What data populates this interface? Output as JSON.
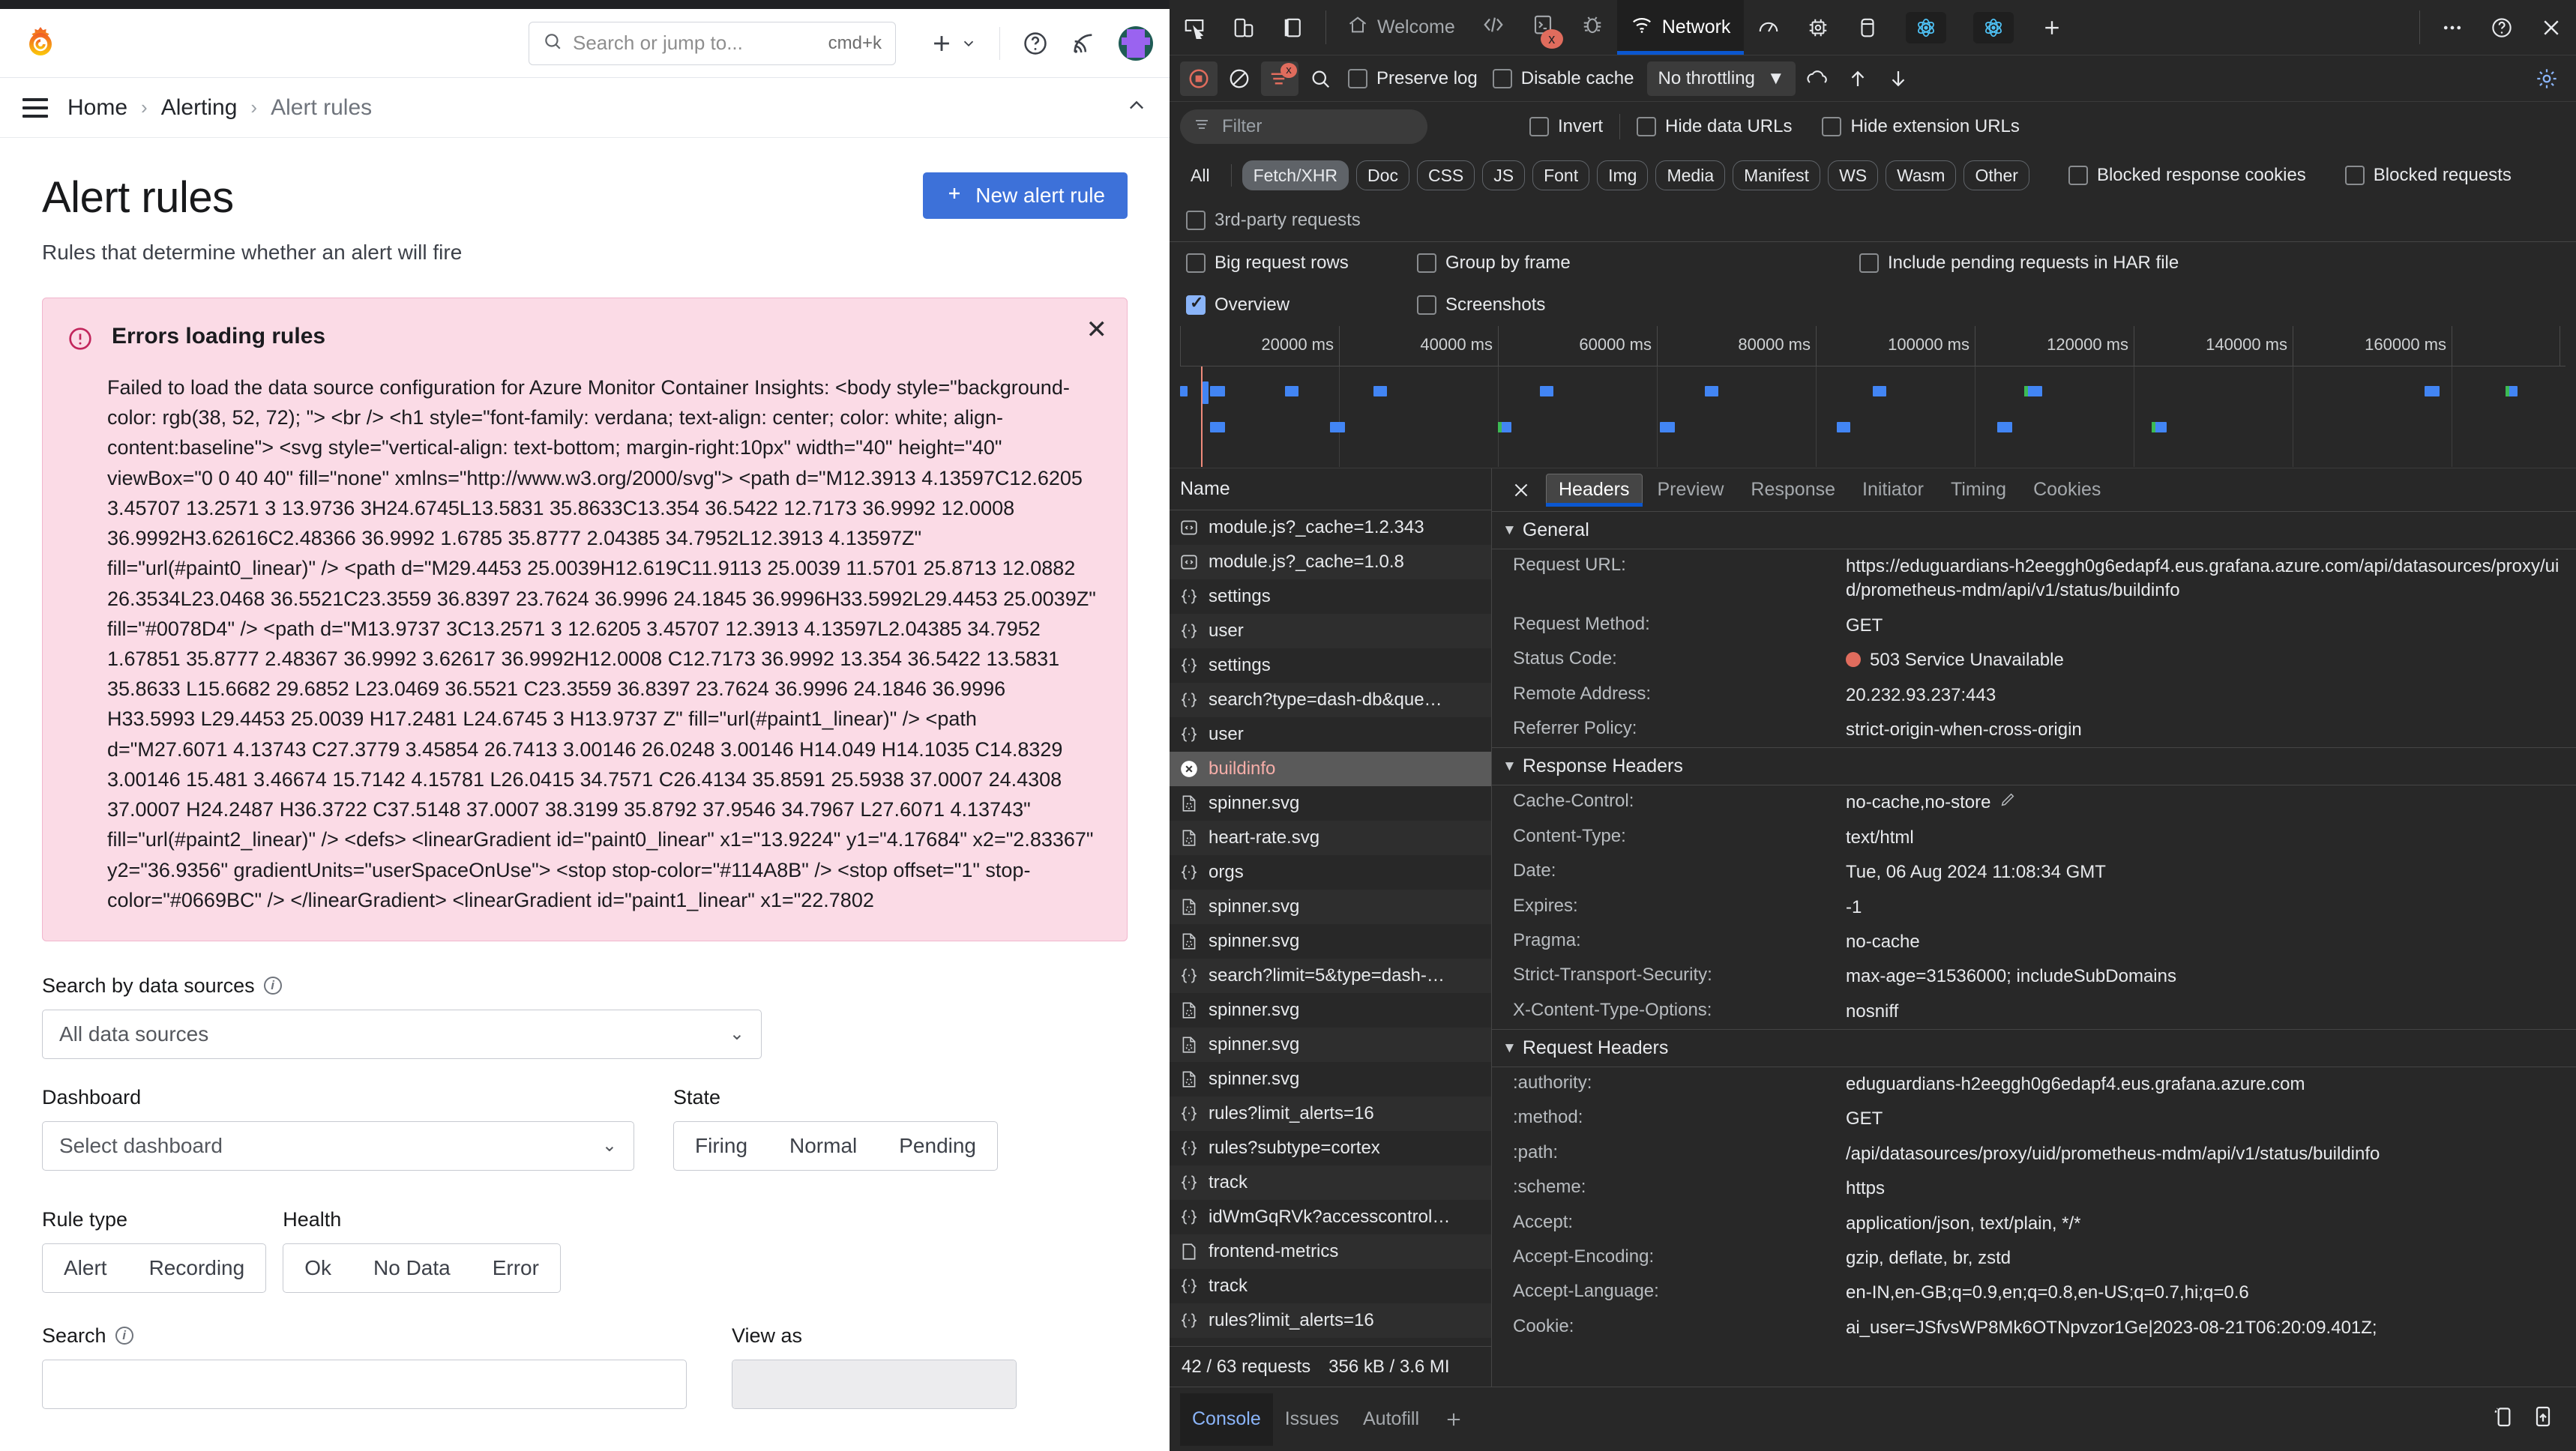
{
  "grafana": {
    "search": {
      "placeholder": "Search or jump to...",
      "shortcut": "cmd+k"
    },
    "breadcrumb": [
      "Home",
      "Alerting",
      "Alert rules"
    ],
    "page_title": "Alert rules",
    "page_subtitle": "Rules that determine whether an alert will fire",
    "new_rule_button": "New alert rule",
    "alert": {
      "title": "Errors loading rules",
      "message": "Failed to load the data source configuration for Azure Monitor Container Insights: <body style=\"background-color: rgb(38, 52, 72); \"> <br /> <h1 style=\"font-family: verdana; text-align: center; color: white; align-content:baseline\"> <svg style=\"vertical-align: text-bottom; margin-right:10px\" width=\"40\" height=\"40\" viewBox=\"0 0 40 40\" fill=\"none\" xmlns=\"http://www.w3.org/2000/svg\"> <path d=\"M12.3913 4.13597C12.6205 3.45707 13.2571 3 13.9736 3H24.6745L13.5831 35.8633C13.354 36.5422 12.7173 36.9992 12.0008 36.9992H3.62616C2.48366 36.9992 1.6785 35.8777 2.04385 34.7952L12.3913 4.13597Z\" fill=\"url(#paint0_linear)\" /> <path d=\"M29.4453 25.0039H12.619C11.9113 25.0039 11.5701 25.8713 12.0882 26.3534L23.0468 36.5521C23.3559 36.8397 23.7624 36.9996 24.1845 36.9996H33.5992L29.4453 25.0039Z\" fill=\"#0078D4\" /> <path d=\"M13.9737 3C13.2571 3 12.6205 3.45707 12.3913 4.13597L2.04385 34.7952 1.67851 35.8777 2.48367 36.9992 3.62617 36.9992H12.0008 C12.7173 36.9992 13.354 36.5422 13.5831 35.8633 L15.6682 29.6852 L23.0469 36.5521 C23.3559 36.8397 23.7624 36.9996 24.1846 36.9996 H33.5993 L29.4453 25.0039 H17.2481 L24.6745 3 H13.9737 Z\" fill=\"url(#paint1_linear)\" /> <path d=\"M27.6071 4.13743 C27.3779 3.45854 26.7413 3.00146 26.0248 3.00146 H14.049 H14.1035 C14.8329 3.00146 15.481 3.46674 15.7142 4.15781 L26.0415 34.7571 C26.4134 35.8591 25.5938 37.0007 24.4308 37.0007 H24.2487 H36.3722 C37.5148 37.0007 38.3199 35.8792 37.9546 34.7967 L27.6071 4.13743\" fill=\"url(#paint2_linear)\" /> <defs> <linearGradient id=\"paint0_linear\" x1=\"13.9224\" y1=\"4.17684\" x2=\"2.83367\" y2=\"36.9356\" gradientUnits=\"userSpaceOnUse\"> <stop stop-color=\"#114A8B\" /> <stop offset=\"1\" stop-color=\"#0669BC\" /> </linearGradient> <linearGradient id=\"paint1_linear\" x1=\"22.7802",
      "close": "✕"
    },
    "filters": {
      "data_sources_label": "Search by data sources",
      "data_sources_value": "All data sources",
      "dashboard_label": "Dashboard",
      "dashboard_value": "Select dashboard",
      "state_label": "State",
      "state_options": [
        "Firing",
        "Normal",
        "Pending"
      ],
      "rule_type_label": "Rule type",
      "rule_type_options": [
        "Alert",
        "Recording"
      ],
      "health_label": "Health",
      "health_options": [
        "Ok",
        "No Data",
        "Error"
      ],
      "search_label": "Search",
      "view_as_label": "View as"
    }
  },
  "devtools": {
    "panel_tabs": [
      {
        "label": "Welcome",
        "icon": "home-icon",
        "active": false
      },
      {
        "label": "",
        "icon": "elements-icon",
        "active": false
      },
      {
        "label": "",
        "icon": "console-error-icon",
        "active": false
      },
      {
        "label": "",
        "icon": "bug-icon",
        "active": false
      },
      {
        "label": "Network",
        "icon": "network-icon",
        "active": true
      }
    ],
    "right_tab_icons": [
      "performance-icon",
      "memory-icon",
      "application-icon",
      "react-components-icon",
      "react-profiler-icon",
      "more-tabs-icon"
    ],
    "window_icons": [
      "more-options-icon",
      "help-icon",
      "close-icon"
    ],
    "toolbar": {
      "record_label": "record",
      "clear_label": "clear",
      "filter_label": "Filter",
      "search_label": "search",
      "preserve_log": "Preserve log",
      "disable_cache": "Disable cache",
      "throttling": "No throttling"
    },
    "filter_row": {
      "placeholder": "Filter",
      "invert": "Invert",
      "hide_data_urls": "Hide data URLs",
      "hide_extension_urls": "Hide extension URLs"
    },
    "resource_types": [
      "All",
      "Fetch/XHR",
      "Doc",
      "CSS",
      "JS",
      "Font",
      "Img",
      "Media",
      "Manifest",
      "WS",
      "Wasm",
      "Other"
    ],
    "selected_resource_type": "Fetch/XHR",
    "blocked_response_cookies": "Blocked response cookies",
    "blocked_requests": "Blocked requests",
    "third_party_requests": "3rd-party requests",
    "settings_checks": {
      "big_request_rows": "Big request rows",
      "group_by_frame": "Group by frame",
      "include_pending_har": "Include pending requests in HAR file",
      "overview": "Overview",
      "screenshots": "Screenshots"
    },
    "overview_ticks": [
      "20000 ms",
      "40000 ms",
      "60000 ms",
      "80000 ms",
      "100000 ms",
      "120000 ms",
      "140000 ms",
      "160000 ms"
    ],
    "request_table": {
      "column_header": "Name",
      "rows": [
        {
          "name": "module.js?_cache=1.2.343",
          "icon": "js-icon",
          "selected": false
        },
        {
          "name": "module.js?_cache=1.0.8",
          "icon": "js-icon",
          "selected": false
        },
        {
          "name": "settings",
          "icon": "json-icon",
          "selected": false
        },
        {
          "name": "user",
          "icon": "json-icon",
          "selected": false
        },
        {
          "name": "settings",
          "icon": "json-icon",
          "selected": false
        },
        {
          "name": "search?type=dash-db&que…",
          "icon": "json-icon",
          "selected": false
        },
        {
          "name": "user",
          "icon": "json-icon",
          "selected": false
        },
        {
          "name": "buildinfo",
          "icon": "error-icon",
          "selected": true
        },
        {
          "name": "spinner.svg",
          "icon": "image-icon",
          "selected": false
        },
        {
          "name": "heart-rate.svg",
          "icon": "image-icon",
          "selected": false
        },
        {
          "name": "orgs",
          "icon": "json-icon",
          "selected": false
        },
        {
          "name": "spinner.svg",
          "icon": "image-icon",
          "selected": false
        },
        {
          "name": "spinner.svg",
          "icon": "image-icon",
          "selected": false
        },
        {
          "name": "search?limit=5&type=dash-…",
          "icon": "json-icon",
          "selected": false
        },
        {
          "name": "spinner.svg",
          "icon": "image-icon",
          "selected": false
        },
        {
          "name": "spinner.svg",
          "icon": "image-icon",
          "selected": false
        },
        {
          "name": "spinner.svg",
          "icon": "image-icon",
          "selected": false
        },
        {
          "name": "rules?limit_alerts=16",
          "icon": "json-icon",
          "selected": false
        },
        {
          "name": "rules?subtype=cortex",
          "icon": "json-icon",
          "selected": false
        },
        {
          "name": "track",
          "icon": "json-icon",
          "selected": false
        },
        {
          "name": "idWmGqRVk?accesscontrol…",
          "icon": "json-icon",
          "selected": false
        },
        {
          "name": "frontend-metrics",
          "icon": "doc-icon",
          "selected": false
        },
        {
          "name": "track",
          "icon": "json-icon",
          "selected": false
        },
        {
          "name": "rules?limit_alerts=16",
          "icon": "json-icon",
          "selected": false
        }
      ],
      "status_requests": "42 / 63 requests",
      "status_transferred": "356 kB / 3.6 MI"
    },
    "detail_tabs": [
      "Headers",
      "Preview",
      "Response",
      "Initiator",
      "Timing",
      "Cookies"
    ],
    "detail_active_tab": "Headers",
    "general_section": {
      "title": "General",
      "rows": [
        {
          "key": "Request URL:",
          "value": "https://eduguardians-h2eeggh0g6edapf4.eus.grafana.azure.com/api/datasources/proxy/uid/prometheus-mdm/api/v1/status/buildinfo"
        },
        {
          "key": "Request Method:",
          "value": "GET"
        },
        {
          "key": "Status Code:",
          "value": "503 Service Unavailable",
          "dot": true
        },
        {
          "key": "Remote Address:",
          "value": "20.232.93.237:443"
        },
        {
          "key": "Referrer Policy:",
          "value": "strict-origin-when-cross-origin"
        }
      ]
    },
    "response_headers": {
      "title": "Response Headers",
      "rows": [
        {
          "key": "Cache-Control:",
          "value": "no-cache,no-store",
          "pencil": true
        },
        {
          "key": "Content-Type:",
          "value": "text/html"
        },
        {
          "key": "Date:",
          "value": "Tue, 06 Aug 2024 11:08:34 GMT"
        },
        {
          "key": "Expires:",
          "value": "-1"
        },
        {
          "key": "Pragma:",
          "value": "no-cache"
        },
        {
          "key": "Strict-Transport-Security:",
          "value": "max-age=31536000; includeSubDomains"
        },
        {
          "key": "X-Content-Type-Options:",
          "value": "nosniff"
        }
      ]
    },
    "request_headers": {
      "title": "Request Headers",
      "rows": [
        {
          "key": ":authority:",
          "value": "eduguardians-h2eeggh0g6edapf4.eus.grafana.azure.com"
        },
        {
          "key": ":method:",
          "value": "GET"
        },
        {
          "key": ":path:",
          "value": "/api/datasources/proxy/uid/prometheus-mdm/api/v1/status/buildinfo"
        },
        {
          "key": ":scheme:",
          "value": "https"
        },
        {
          "key": "Accept:",
          "value": "application/json, text/plain, */*"
        },
        {
          "key": "Accept-Encoding:",
          "value": "gzip, deflate, br, zstd"
        },
        {
          "key": "Accept-Language:",
          "value": "en-IN,en-GB;q=0.9,en;q=0.8,en-US;q=0.7,hi;q=0.6"
        },
        {
          "key": "Cookie:",
          "value": "ai_user=JSfvsWP8Mk6OTNpvzor1Ge|2023-08-21T06:20:09.401Z;"
        }
      ]
    },
    "drawer": {
      "tabs": [
        "Console",
        "Issues",
        "Autofill"
      ],
      "active": "Console"
    }
  }
}
